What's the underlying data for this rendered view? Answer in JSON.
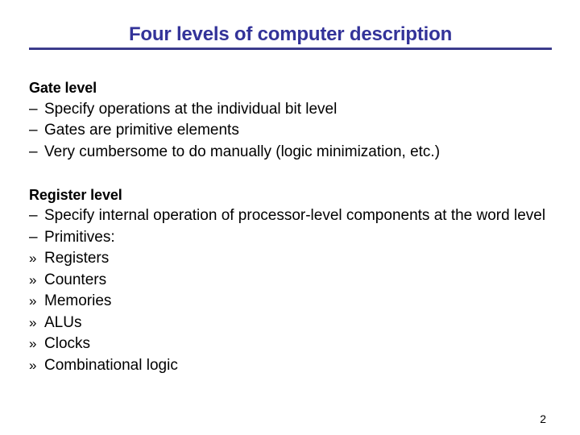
{
  "slide": {
    "title": "Four levels of computer description",
    "title_color": "#333399",
    "rule_color": "#3b3b8c",
    "background_color": "#ffffff",
    "text_color": "#000000",
    "page_number": "2"
  },
  "sections": [
    {
      "heading": "Gate level",
      "bullets": [
        {
          "marker": "–",
          "text": "Specify operations at the individual bit level"
        },
        {
          "marker": "–",
          "text": "Gates are primitive elements"
        },
        {
          "marker": "–",
          "text": "Very cumbersome to do manually (logic minimization, etc.)"
        }
      ]
    },
    {
      "heading": "Register level",
      "bullets": [
        {
          "marker": "–",
          "text": "Specify internal operation of processor-level components at the word level"
        },
        {
          "marker": "–",
          "text": "Primitives:"
        },
        {
          "marker": "»",
          "text": "Registers"
        },
        {
          "marker": "»",
          "text": "Counters"
        },
        {
          "marker": "»",
          "text": "Memories"
        },
        {
          "marker": "»",
          "text": "ALUs"
        },
        {
          "marker": "»",
          "text": "Clocks"
        },
        {
          "marker": "»",
          "text": "Combinational logic"
        }
      ]
    }
  ]
}
